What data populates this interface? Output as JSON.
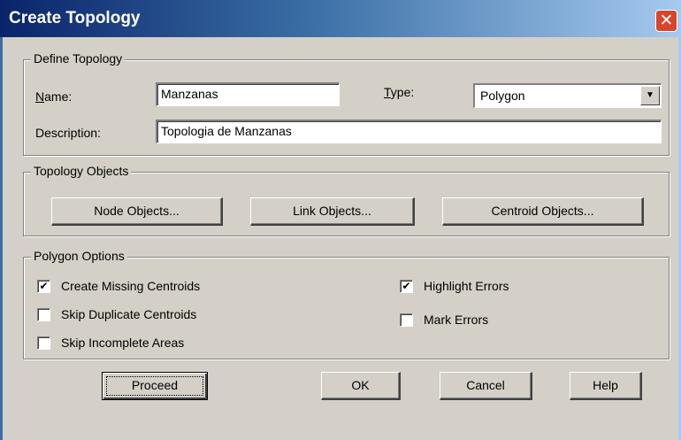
{
  "window": {
    "title": "Create Topology",
    "close_glyph": "✕"
  },
  "define_topology": {
    "legend": "Define Topology",
    "name_label": "Name:",
    "name_value": "Manzanas",
    "type_label": "Type:",
    "type_value": "Polygon",
    "description_label": "Description:",
    "description_value": "Topologia de Manzanas"
  },
  "topology_objects": {
    "legend": "Topology Objects",
    "node_button": "Node Objects...",
    "link_button": "Link Objects...",
    "centroid_button": "Centroid Objects..."
  },
  "polygon_options": {
    "legend": "Polygon Options",
    "create_missing_centroids": {
      "label": "Create Missing Centroids",
      "checked": true
    },
    "skip_duplicate_centroids": {
      "label": "Skip Duplicate Centroids",
      "checked": false
    },
    "skip_incomplete_areas": {
      "label": "Skip Incomplete Areas",
      "checked": false
    },
    "highlight_errors": {
      "label": "Highlight Errors",
      "checked": true
    },
    "mark_errors": {
      "label": "Mark Errors",
      "checked": false
    }
  },
  "buttons": {
    "proceed": "Proceed",
    "ok": "OK",
    "cancel": "Cancel",
    "help": "Help"
  },
  "icons": {
    "dropdown": "chevron-down-icon",
    "close": "close-icon",
    "check": "checkmark-icon"
  },
  "colors": {
    "titlebar_start": "#0a246a",
    "titlebar_end": "#a6caf0",
    "face": "#d4d0c8",
    "close": "#d8452b"
  }
}
